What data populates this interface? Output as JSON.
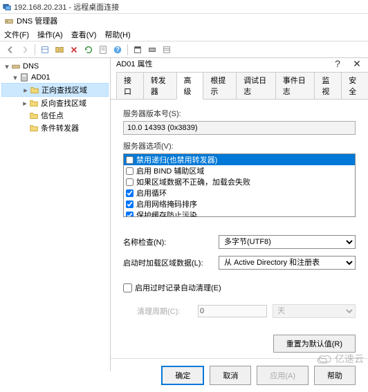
{
  "window": {
    "title": "192.168.20.231 - 远程桌面连接",
    "app_title": "DNS 管理器"
  },
  "menu": {
    "file": "文件(F)",
    "action": "操作(A)",
    "view": "查看(V)",
    "help": "帮助(H)"
  },
  "tree": {
    "root": "DNS",
    "server": "AD01",
    "nodes": {
      "fwd_zone": "正向查找区域",
      "rev_zone": "反向查找区域",
      "trust": "信任点",
      "cond_fwd": "条件转发器"
    }
  },
  "dialog": {
    "title": "AD01 属性",
    "tabs": {
      "iface": "接口",
      "forwarders": "转发器",
      "advanced": "高级",
      "hints": "根提示",
      "debug": "调试日志",
      "event": "事件日志",
      "monitor": "监视",
      "security": "安全"
    },
    "version_label": "服务器版本号(S):",
    "version_value": "10.0 14393 (0x3839)",
    "options_label": "服务器选项(V):",
    "options": [
      {
        "label": "禁用递归(也禁用转发器)",
        "checked": false,
        "selected": true
      },
      {
        "label": "启用 BIND 辅助区域",
        "checked": false,
        "selected": false
      },
      {
        "label": "如果区域数据不正确，加载会失败",
        "checked": false,
        "selected": false
      },
      {
        "label": "启用循环",
        "checked": true,
        "selected": false
      },
      {
        "label": "启用网络掩码排序",
        "checked": true,
        "selected": false
      },
      {
        "label": "保护缓存防止污染",
        "checked": true,
        "selected": false
      }
    ],
    "name_check_label": "名称检查(N):",
    "name_check_value": "多字节(UTF8)",
    "load_zone_label": "启动时加载区域数据(L):",
    "load_zone_value": "从 Active Directory 和注册表",
    "auto_cleanup_label": "启用过时记录自动清理(E)",
    "cleanup_period_label": "清理周期(C):",
    "cleanup_value": "0",
    "cleanup_unit": "天",
    "reset_btn": "重置为默认值(R)",
    "ok": "确定",
    "cancel": "取消",
    "apply": "应用(A)",
    "help": "帮助"
  },
  "watermark": "亿速云"
}
